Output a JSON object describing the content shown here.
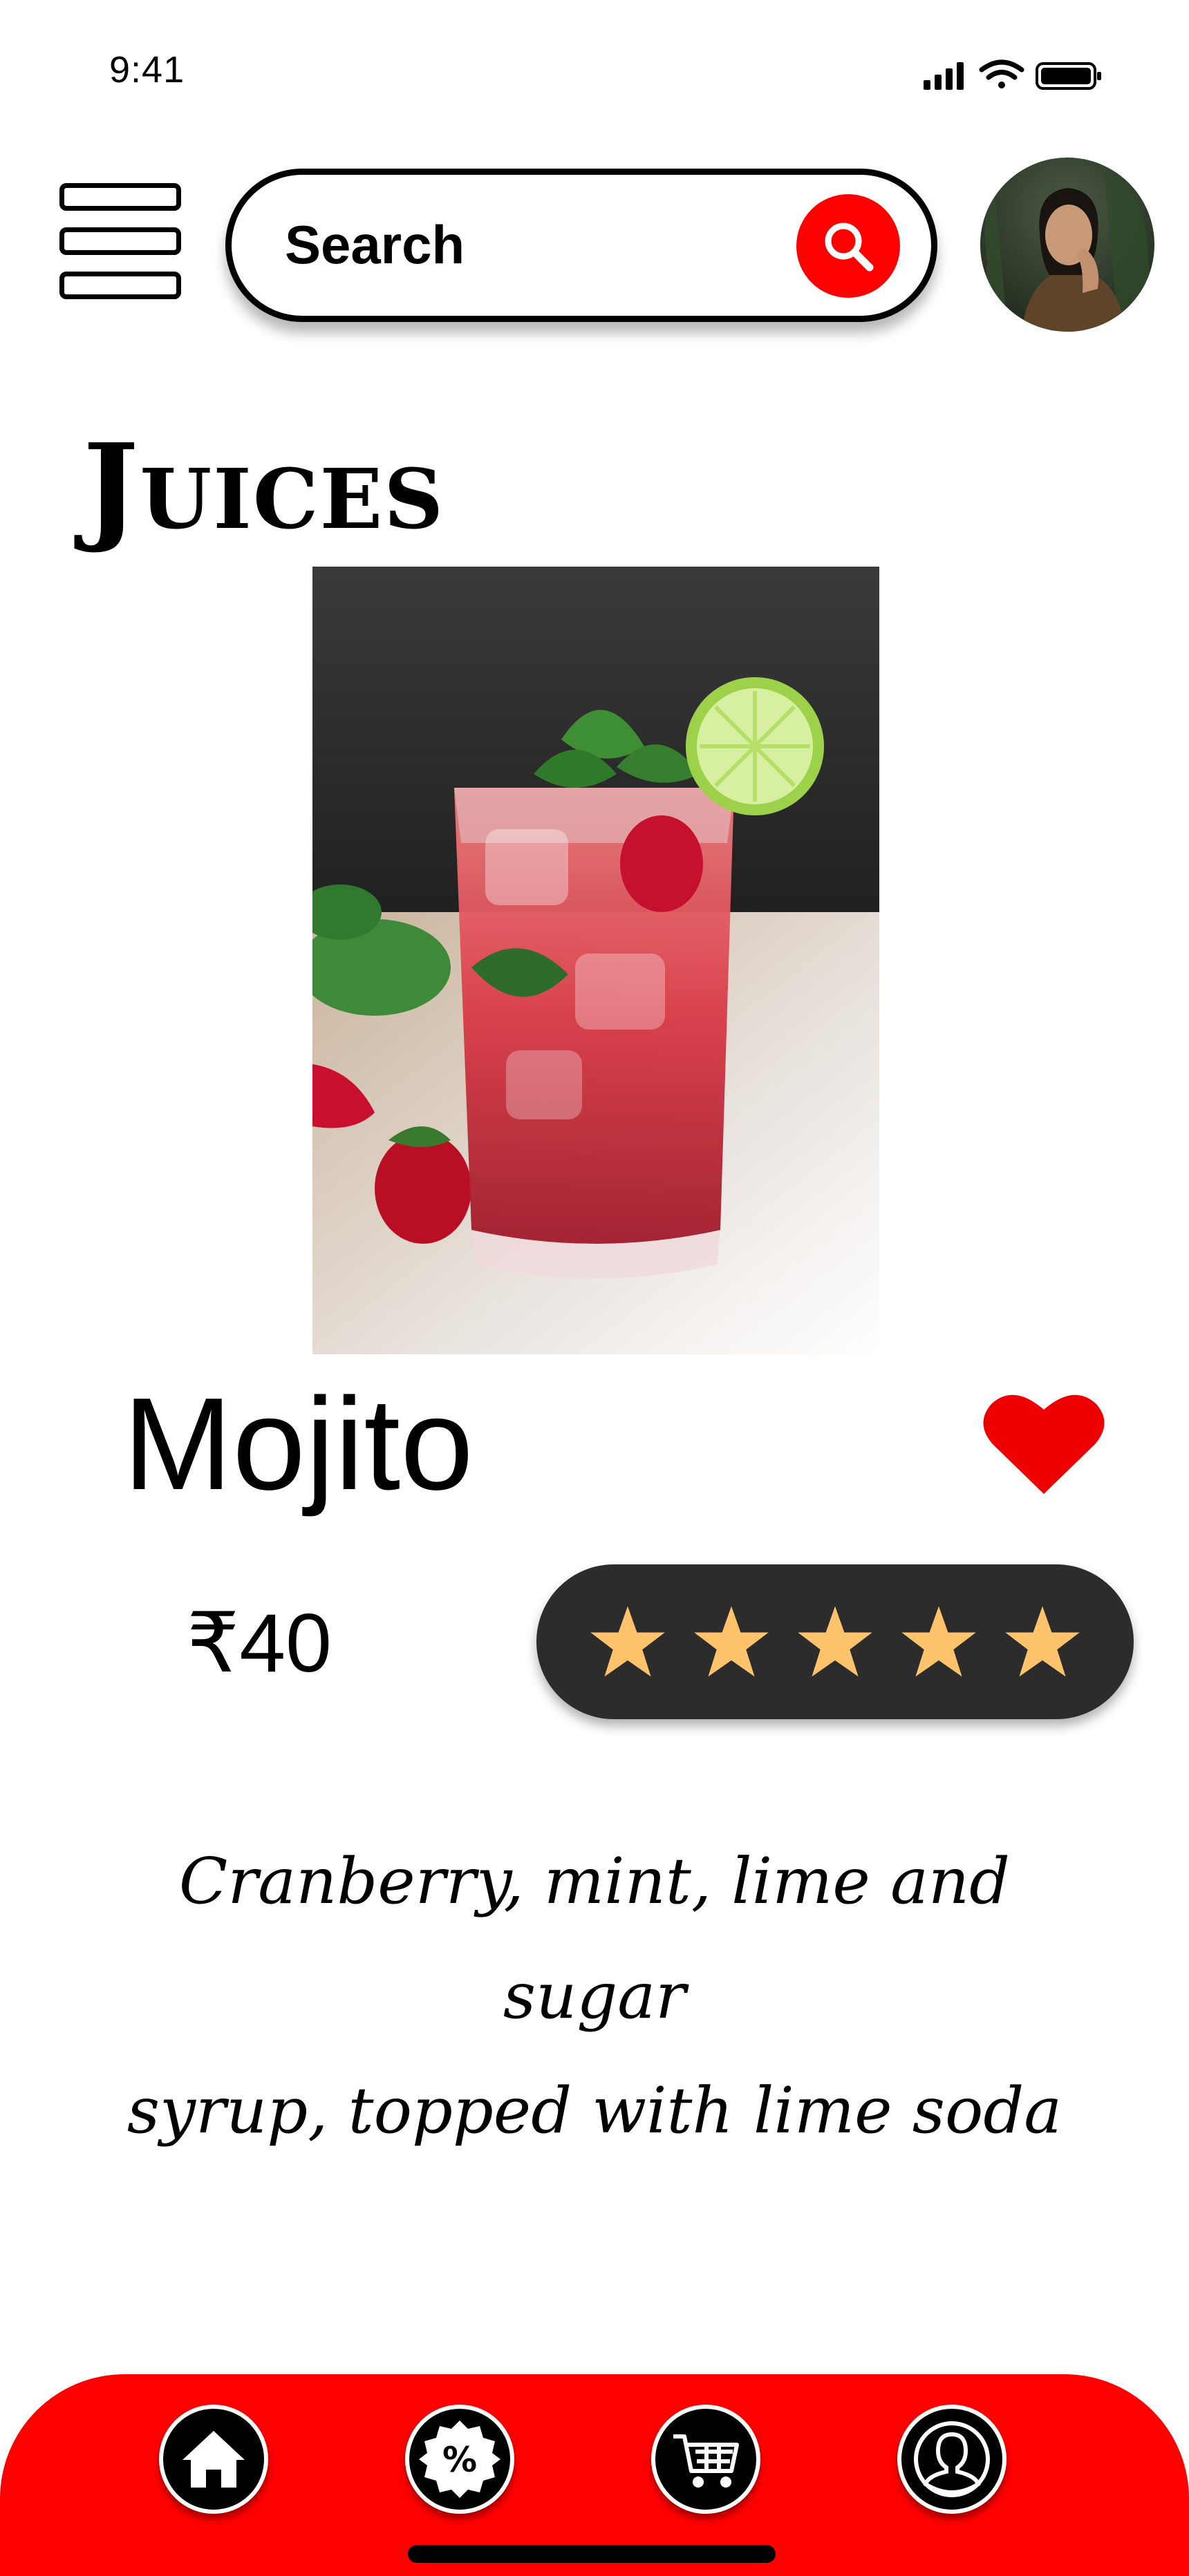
{
  "status_bar": {
    "time": "9:41"
  },
  "header": {
    "search": {
      "placeholder": "Search"
    }
  },
  "category": {
    "title": "Juices"
  },
  "product": {
    "name": "Mojito",
    "price": "₹40",
    "rating": {
      "value": 5,
      "max": 5
    },
    "favorited": true,
    "description_lines": [
      "Cranberry, mint, lime and sugar",
      "syrup, topped with lime soda"
    ]
  },
  "bottom_nav": {
    "items": [
      {
        "icon": "home-icon"
      },
      {
        "icon": "discount-icon"
      },
      {
        "icon": "cart-icon"
      },
      {
        "icon": "profile-icon"
      }
    ]
  },
  "colors": {
    "accent": "#ff0000",
    "rating_pill": "#2c2c2c",
    "star": "#ffc36b",
    "heart": "#ee0000"
  }
}
